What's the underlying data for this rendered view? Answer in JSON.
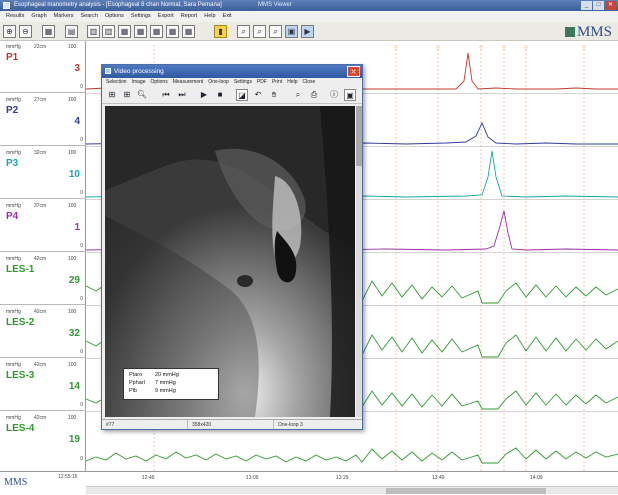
{
  "window": {
    "title": "Esophageal manometry analysis - [Esophageal 8 chan Normal, Sara Pemana]",
    "center_title": "MMS Viewer",
    "min": "_",
    "max": "□",
    "close": "✕"
  },
  "menu": [
    "Results",
    "Graph",
    "Markers",
    "Search",
    "Options",
    "Settings",
    "Export",
    "Report",
    "Help",
    "Exit"
  ],
  "toolbar": {
    "icons": [
      "zoom-in-icon",
      "zoom-out-icon",
      "view-icon",
      "view-icon",
      "layout-icon",
      "layout-icon",
      "layout-icon",
      "layout-icon",
      "layout-icon",
      "layout-icon",
      "marker-icon",
      "search-icon",
      "search-icon",
      "search-icon",
      "export-icon",
      "video-icon"
    ],
    "logo": "MMS"
  },
  "channels": [
    {
      "unit": "mmHg",
      "depth": "22cm",
      "scale": "100",
      "name": "P1",
      "value": "3",
      "zero": "0",
      "color": "#c0392b"
    },
    {
      "unit": "mmHg",
      "depth": "27cm",
      "scale": "100",
      "name": "P2",
      "value": "4",
      "zero": "0",
      "color": "#2f3a9c"
    },
    {
      "unit": "mmHg",
      "depth": "32cm",
      "scale": "100",
      "name": "P3",
      "value": "10",
      "zero": "0",
      "color": "#17a6a6"
    },
    {
      "unit": "mmHg",
      "depth": "37cm",
      "scale": "100",
      "name": "P4",
      "value": "1",
      "zero": "0",
      "color": "#9b2fa6"
    },
    {
      "unit": "mmHg",
      "depth": "42cm",
      "scale": "100",
      "name": "LES-1",
      "value": "29",
      "zero": "0",
      "color": "#2d9a2d"
    },
    {
      "unit": "mmHg",
      "depth": "42cm",
      "scale": "100",
      "name": "LES-2",
      "value": "32",
      "zero": "0",
      "color": "#2d9a2d"
    },
    {
      "unit": "mmHg",
      "depth": "42cm",
      "scale": "100",
      "name": "LES-3",
      "value": "14",
      "zero": "0",
      "color": "#2d9a2d"
    },
    {
      "unit": "mmHg",
      "depth": "42cm",
      "scale": "100",
      "name": "LES-4",
      "value": "19",
      "zero": "0",
      "color": "#2d9a2d"
    }
  ],
  "bottom": {
    "logo": "MMS",
    "time": "12:55:15",
    "ticks": [
      "12:49",
      "13:09",
      "13:29",
      "13:49",
      "14:09"
    ]
  },
  "dialog": {
    "title": "Video processing",
    "close": "✕",
    "menu": [
      "Selection",
      "Image",
      "Options",
      "Measurement",
      "One-loop",
      "Settings",
      "PDF",
      "Print",
      "Help",
      "Close"
    ],
    "overlay": [
      {
        "label": "Ptaro",
        "value": "20 mmHg"
      },
      {
        "label": "Ppharl",
        "value": "7 mmHg"
      },
      {
        "label": "Plb",
        "value": "9 mmHg"
      }
    ],
    "status": [
      "#77",
      "358x420",
      "One-loop 3"
    ]
  }
}
